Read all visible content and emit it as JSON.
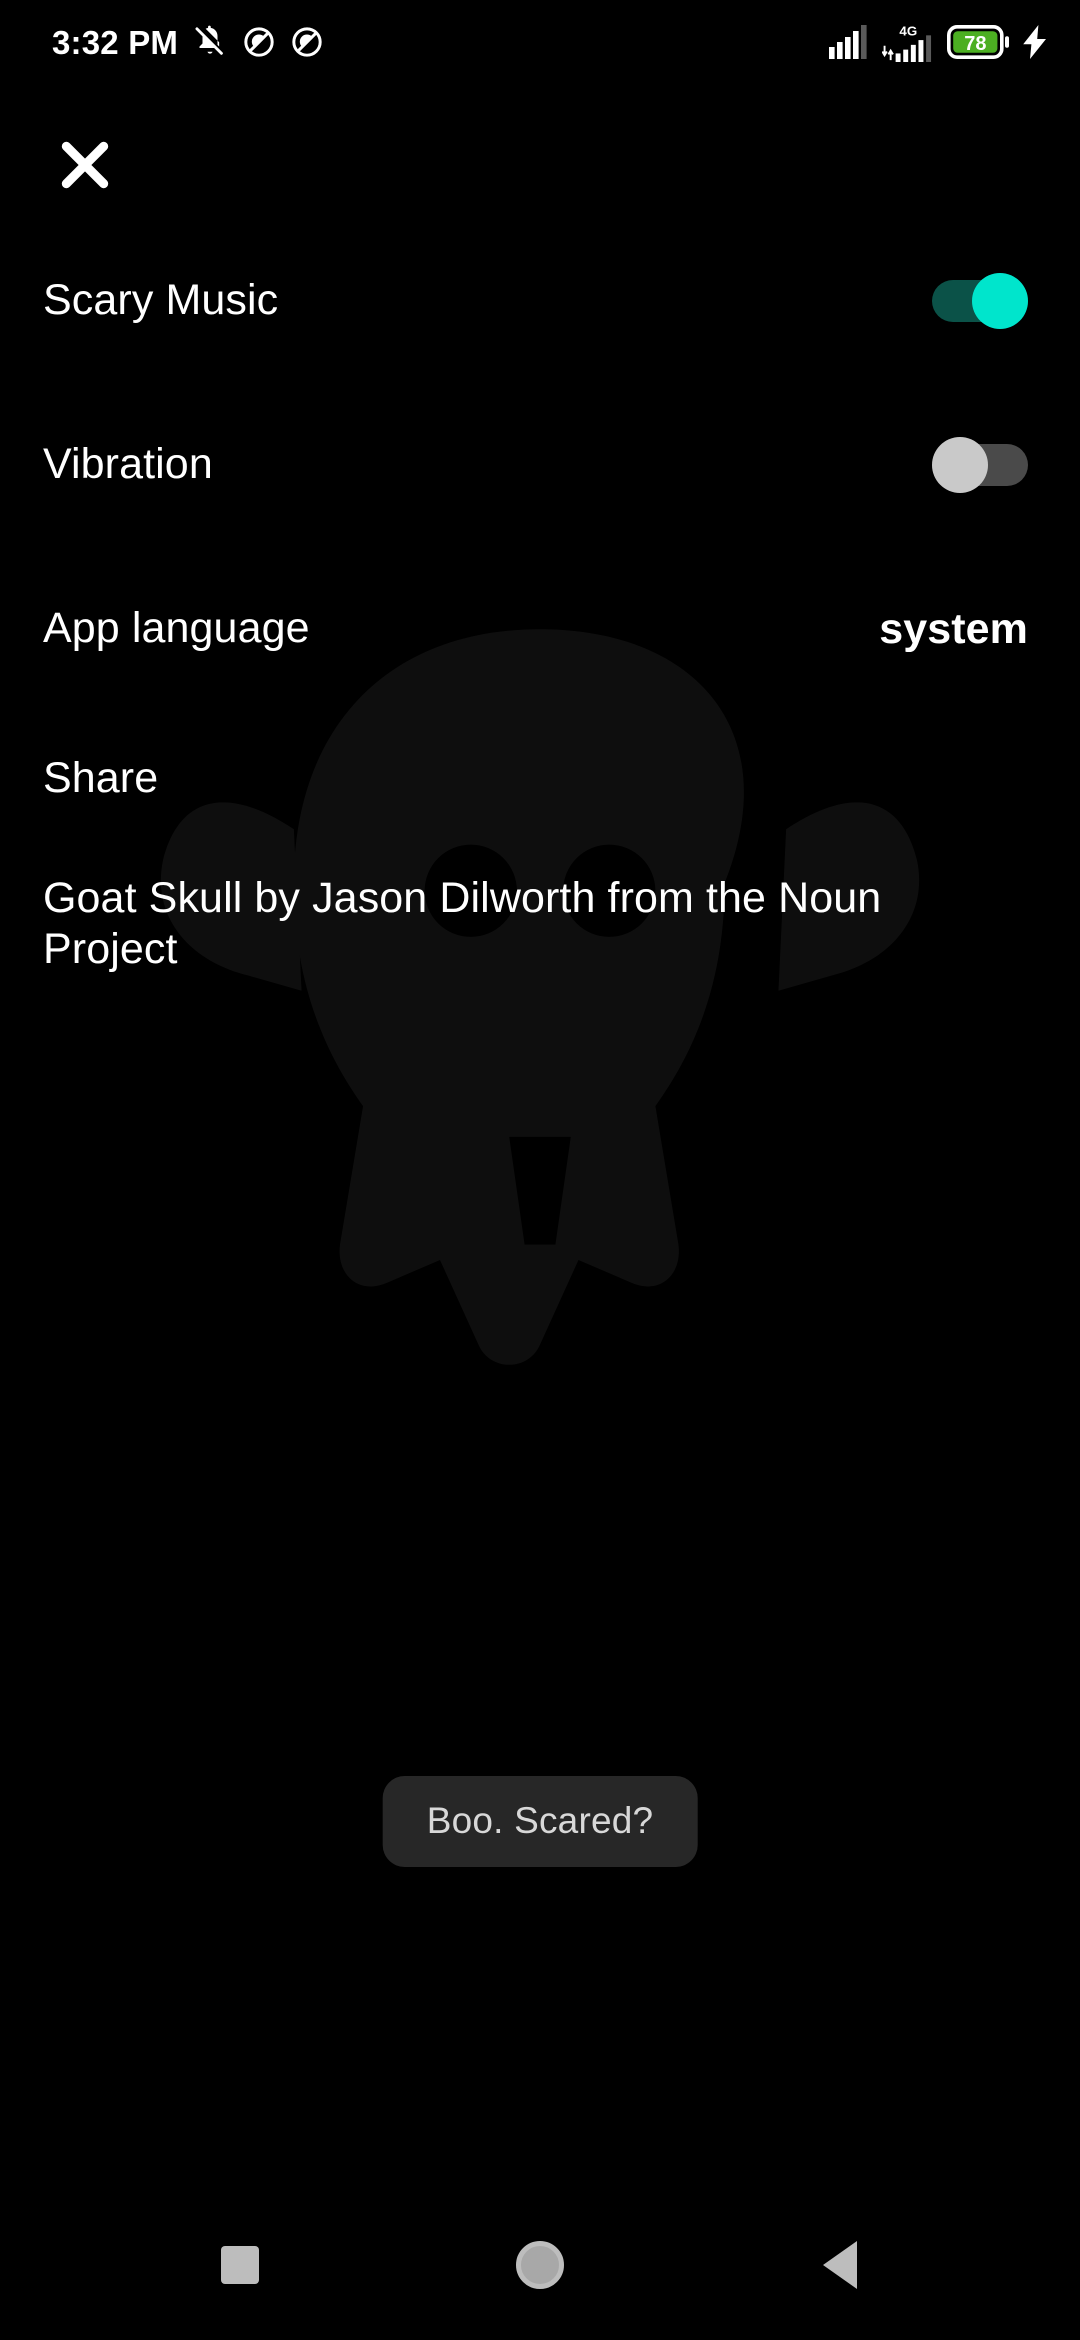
{
  "status_bar": {
    "time": "3:32 PM",
    "icons_left": [
      "bell-off-icon",
      "do-not-disturb-icon",
      "do-not-disturb-icon"
    ],
    "icons_right": [
      "signal-bars-icon",
      "mobile-data-4g-icon",
      "battery-icon",
      "charging-bolt-icon"
    ],
    "network_label": "4G",
    "battery_percent": "78",
    "battery_color": "#4caf22",
    "charging": true
  },
  "header": {
    "close_label": "close-icon"
  },
  "settings": {
    "rows": [
      {
        "label": "Scary Music",
        "control": "toggle",
        "state": "on",
        "value": ""
      },
      {
        "label": "Vibration",
        "control": "toggle",
        "state": "off",
        "value": ""
      },
      {
        "label": "App language",
        "control": "value",
        "state": "",
        "value": "system"
      },
      {
        "label": "Share",
        "control": "none",
        "state": "",
        "value": ""
      }
    ],
    "attribution": "Goat Skull by Jason Dilworth from the Noun Project"
  },
  "toast": {
    "message": "Boo. Scared?"
  },
  "nav_bar": {
    "recents_label": "recents-button",
    "home_label": "home-button",
    "back_label": "back-button"
  },
  "colors": {
    "background": "#000000",
    "text": "#ffffff",
    "toggle_on_track": "#0b5248",
    "toggle_on_thumb": "#00e5cc",
    "toggle_off_track": "#4a4a4a",
    "toggle_off_thumb": "#c9c9c9",
    "toast_bg": "#272727",
    "toast_text": "#d8d8d8",
    "nav_icon": "#bdbdbd"
  }
}
